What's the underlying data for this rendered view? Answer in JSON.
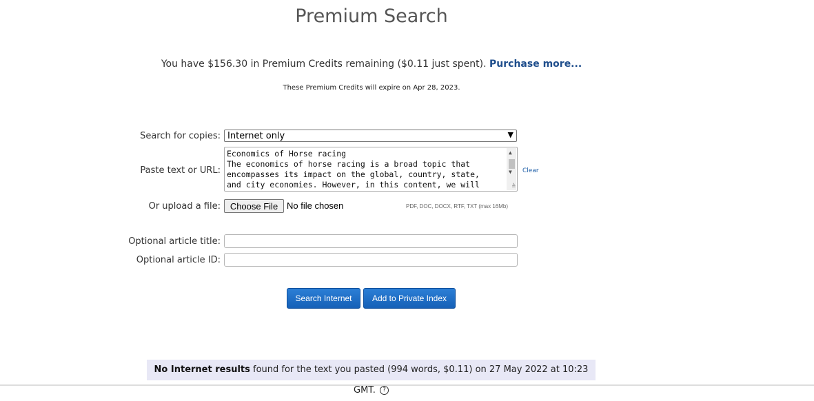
{
  "header": {
    "title": "Premium Search"
  },
  "credits": {
    "text": "You have $156.30 in Premium Credits remaining ($0.11 just spent).",
    "purchase_label": "Purchase more...",
    "expire_note": "These Premium Credits will expire on Apr 28, 2023."
  },
  "form": {
    "search_label": "Search for copies:",
    "search_selected": "Internet only",
    "paste_label": "Paste text or URL:",
    "paste_value": "Economics of Horse racing\nThe economics of horse racing is a broad topic that\nencompasses its impact on the global, country, state,\nand city economies. However, in this content, we will",
    "clear_label": "Clear",
    "upload_label": "Or upload a file:",
    "choose_file_label": "Choose File",
    "file_status": "No file chosen",
    "file_types": "PDF, DOC, DOCX, RTF, TXT (max 16Mb)",
    "title_label": "Optional article title:",
    "title_value": "",
    "id_label": "Optional article ID:",
    "id_value": ""
  },
  "buttons": {
    "search_internet": "Search Internet",
    "add_private": "Add to Private Index"
  },
  "results": {
    "bold": "No Internet results",
    "rest": " found for the text you pasted (994 words, $0.11) on 27 May 2022 at 10:23 GMT.",
    "help_icon": "?"
  },
  "colors": {
    "accent": "#1560b7",
    "link": "#1f4e8c",
    "results_bg": "#e8e8f6"
  },
  "icons": {
    "select": "chevron-down-icon",
    "help": "help-circle-icon"
  }
}
